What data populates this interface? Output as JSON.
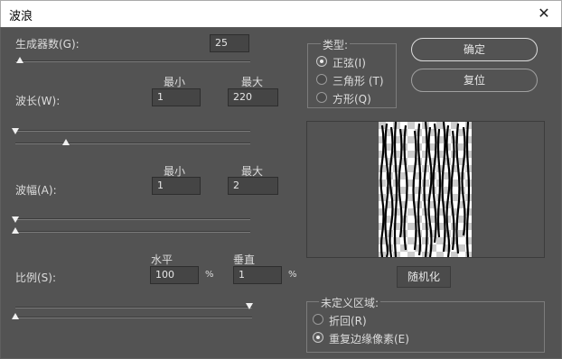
{
  "window": {
    "title": "波浪",
    "close_glyph": "✕"
  },
  "generators": {
    "label": "生成器数(G):",
    "value": "25"
  },
  "wavelength": {
    "label": "波长(W):",
    "min_label": "最小",
    "max_label": "最大",
    "min_value": "1",
    "max_value": "220"
  },
  "amplitude": {
    "label": "波幅(A):",
    "min_label": "最小",
    "max_label": "最大",
    "min_value": "1",
    "max_value": "2"
  },
  "scale": {
    "label": "比例(S):",
    "h_label": "水平",
    "v_label": "垂直",
    "h_value": "100",
    "v_value": "1",
    "unit": "%"
  },
  "type": {
    "title": "类型:",
    "options": [
      {
        "label": "正弦(I)",
        "selected": true
      },
      {
        "label": "三角形 (T)",
        "selected": false
      },
      {
        "label": "方形(Q)",
        "selected": false
      }
    ]
  },
  "buttons": {
    "ok": "确定",
    "reset": "复位",
    "randomize": "随机化"
  },
  "undefined_areas": {
    "title": "未定义区域:",
    "options": [
      {
        "label": "折回(R)",
        "selected": false
      },
      {
        "label": "重复边缘像素(E)",
        "selected": true
      }
    ]
  },
  "colors": {
    "dialog_bg": "#535353",
    "field_bg": "#454545",
    "text": "#dcdcdc"
  },
  "icons": {
    "close": "close-icon",
    "slider": "slider-thumb-icon"
  }
}
